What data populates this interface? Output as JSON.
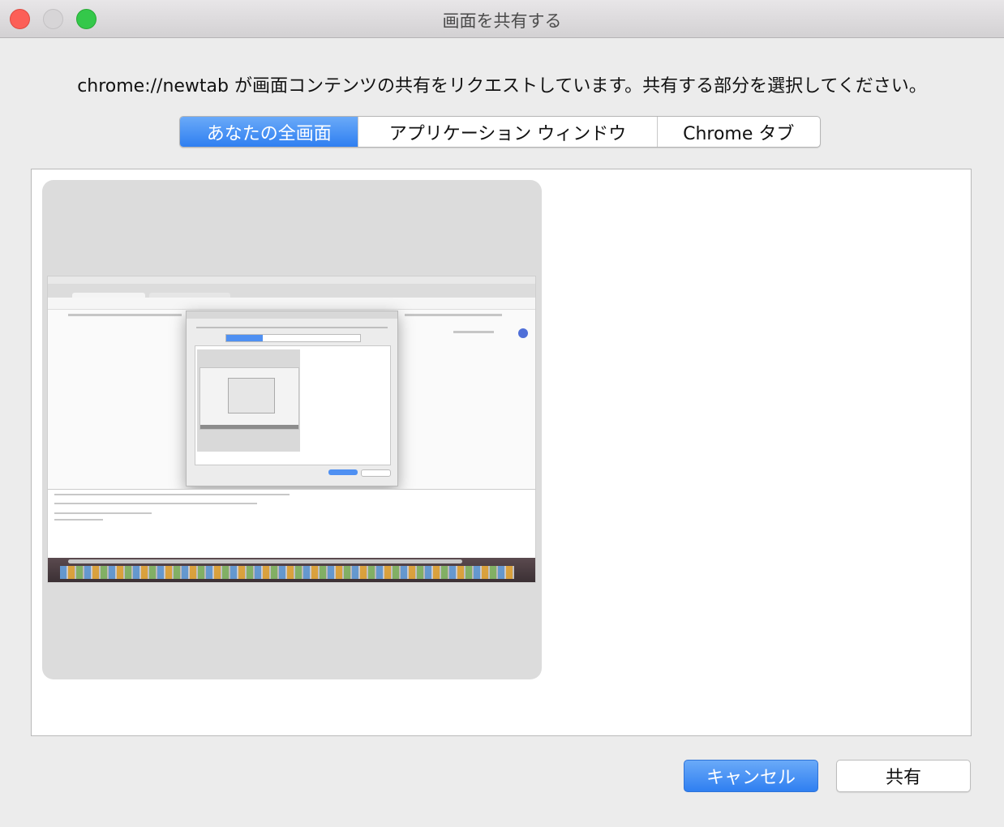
{
  "window": {
    "title": "画面を共有する"
  },
  "prompt": {
    "text": "chrome://newtab が画面コンテンツの共有をリクエストしています。共有する部分を選択してください。"
  },
  "source_tabs": {
    "items": [
      {
        "label": "あなたの全画面",
        "selected": true
      },
      {
        "label": "アプリケーション ウィンドウ",
        "selected": false
      },
      {
        "label": "Chrome タブ",
        "selected": false
      }
    ]
  },
  "screens": {
    "items": [
      {
        "selected": false
      }
    ]
  },
  "buttons": {
    "cancel_label": "キャンセル",
    "share_label": "共有"
  },
  "colors": {
    "accent": "#3b87f5",
    "close": "#fc5f57",
    "zoom": "#34c84a"
  }
}
